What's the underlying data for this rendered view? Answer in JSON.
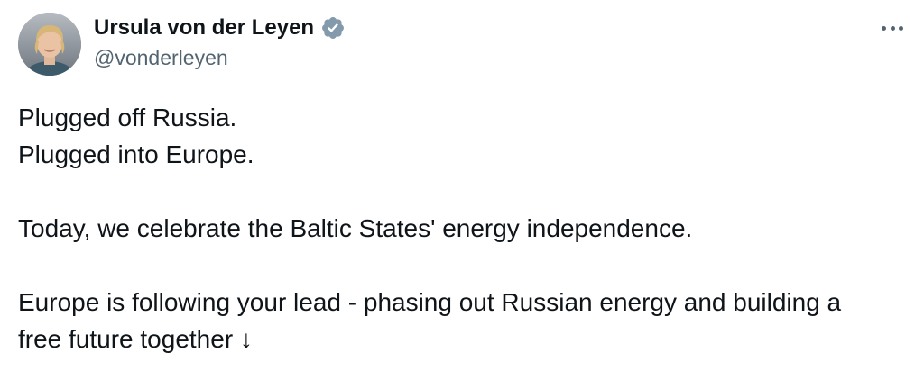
{
  "author": {
    "display_name": "Ursula von der Leyen",
    "handle": "@vonderleyen",
    "verified": true,
    "verified_badge_color": "#829aab"
  },
  "menu": {
    "icon": "more-horizontal-icon"
  },
  "tweet": {
    "lines": [
      "Plugged off Russia.",
      "Plugged into Europe.",
      "",
      "Today, we celebrate the Baltic States' energy independence.",
      "",
      "Europe is following your lead - phasing out Russian energy and building a",
      "free future together ↓"
    ]
  },
  "colors": {
    "text_primary": "#0f1419",
    "text_secondary": "#536471",
    "background": "#ffffff"
  }
}
